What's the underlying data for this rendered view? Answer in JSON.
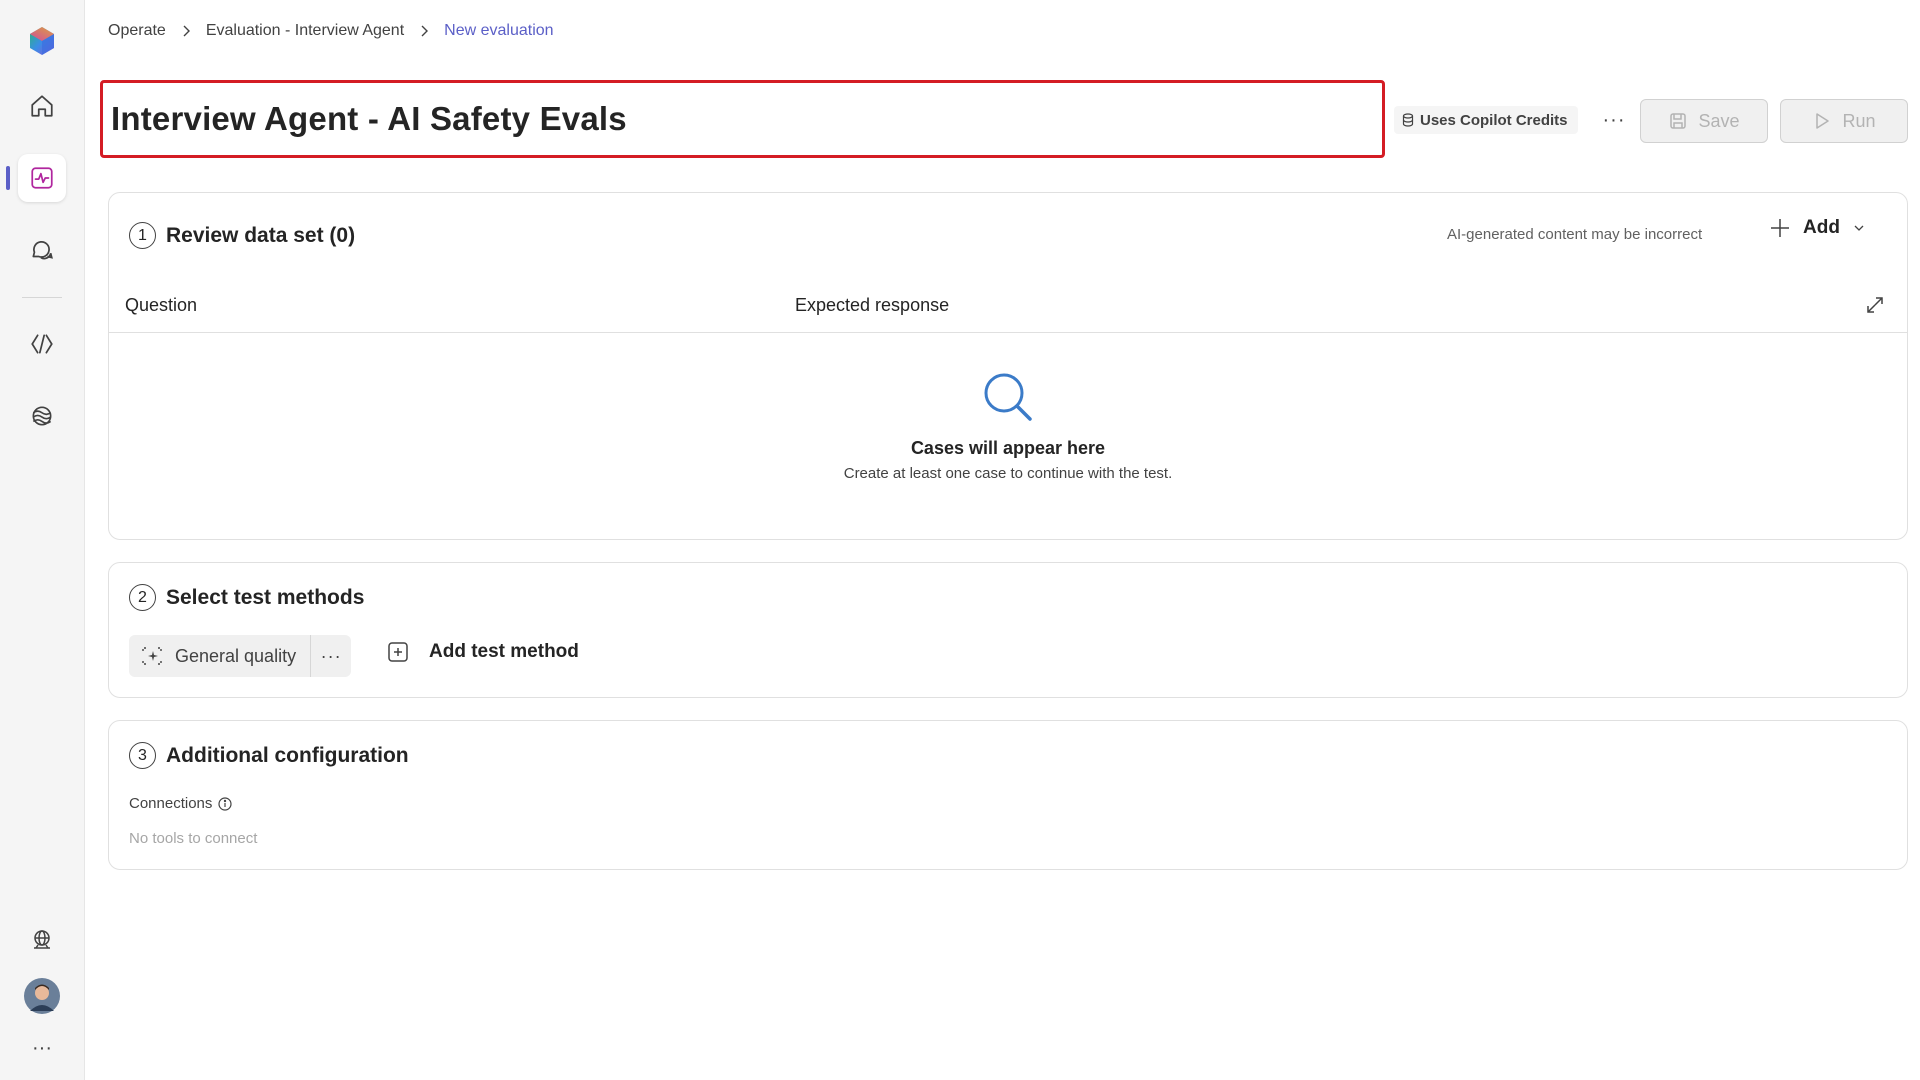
{
  "breadcrumb": {
    "items": [
      "Operate",
      "Evaluation - Interview Agent"
    ],
    "current": "New evaluation"
  },
  "title": "Interview Agent - AI Safety Evals",
  "header": {
    "credits_label": "Uses Copilot Credits",
    "more_label": "···",
    "save_label": "Save",
    "run_label": "Run"
  },
  "section1": {
    "number": "1",
    "title": "Review data set (0)",
    "ai_note": "AI-generated content may be incorrect",
    "add_label": "Add",
    "columns": [
      "Question",
      "Expected response"
    ],
    "empty_title": "Cases will appear here",
    "empty_subtitle": "Create at least one case to continue with the test."
  },
  "section2": {
    "number": "2",
    "title": "Select test methods",
    "method_label": "General quality",
    "method_more": "···",
    "add_method_label": "Add test method"
  },
  "section3": {
    "number": "3",
    "title": "Additional configuration",
    "connections_label": "Connections",
    "connections_empty": "No tools to connect"
  },
  "rail": {
    "more_label": "···",
    "accent": "#5b5fc7"
  },
  "colors": {
    "highlight_border": "#d41c24",
    "link": "#5b5fc7"
  }
}
